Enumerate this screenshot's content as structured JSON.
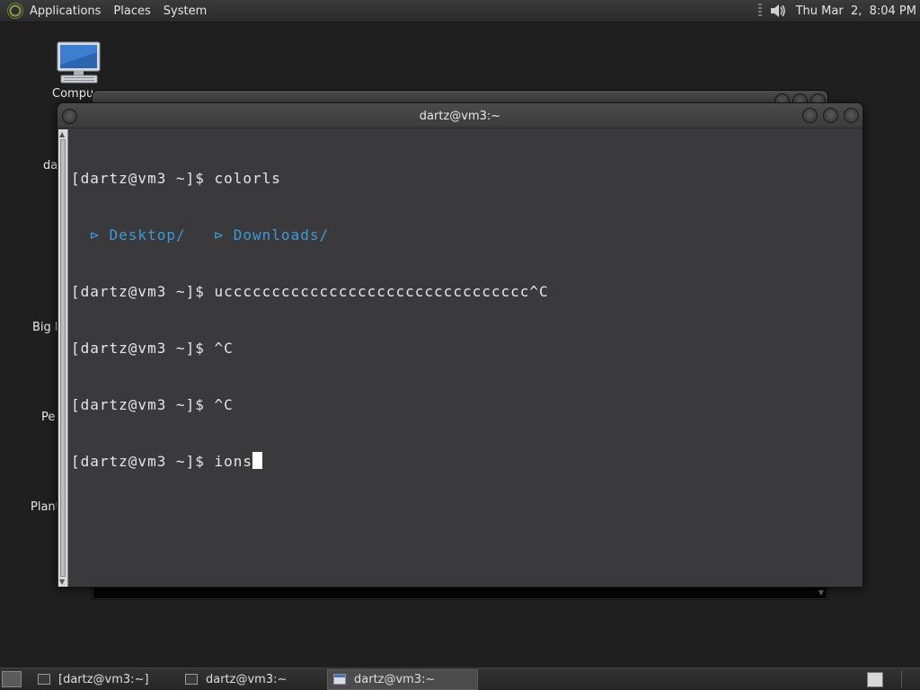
{
  "top_panel": {
    "menus": [
      "Applications",
      "Places",
      "System"
    ],
    "clock": "Thu Mar  2,  8:04 PM"
  },
  "desktop": {
    "icons": [
      "Compu",
      "da",
      "Big M",
      "Pe",
      "Plant"
    ]
  },
  "terminal": {
    "title": "dartz@vm3:~",
    "lines": {
      "l1": "[dartz@vm3 ~]$ colorls",
      "l2_icon1": "  ⊳ ",
      "l2_dir1": "Desktop/",
      "l2_icon2": "   ⊳ ",
      "l2_dir2": "Downloads/",
      "l3": "[dartz@vm3 ~]$ ucccccccccccccccccccccccccccccccc^C",
      "l4": "[dartz@vm3 ~]$ ^C",
      "l5": "[dartz@vm3 ~]$ ^C",
      "l6": "[dartz@vm3 ~]$ ions"
    }
  },
  "taskbar": {
    "tasks": [
      {
        "label": "[dartz@vm3:~]"
      },
      {
        "label": "dartz@vm3:~"
      },
      {
        "label": "dartz@vm3:~"
      }
    ]
  }
}
